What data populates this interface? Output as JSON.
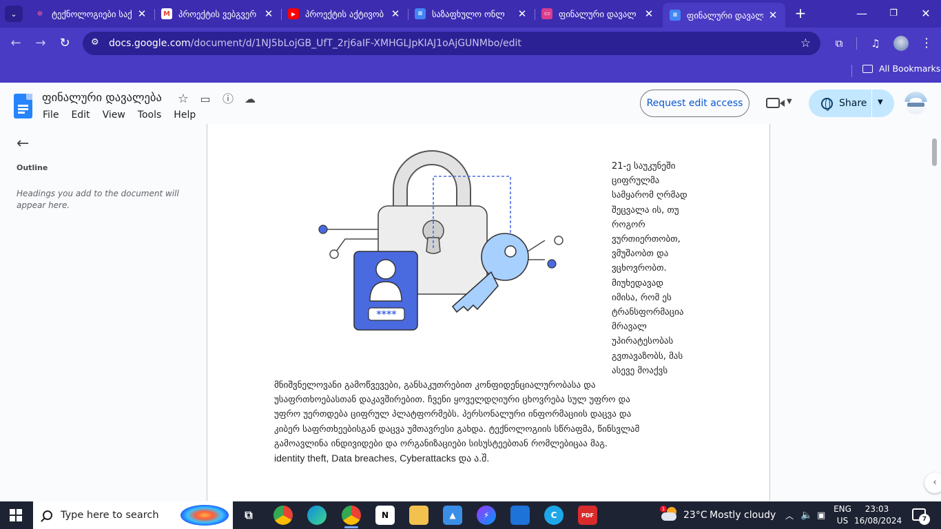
{
  "tabs": [
    {
      "title": "ტექნოლოგიები საქ",
      "favicon": "generic-site-icon",
      "color": "#c5408a"
    },
    {
      "title": "პროექტის ვებგვერ",
      "favicon": "gmail-icon",
      "color": "#ea4335"
    },
    {
      "title": "პროექტის აქტივობ",
      "favicon": "youtube-icon",
      "color": "#ff0000"
    },
    {
      "title": "საზაფხულო ონლ",
      "favicon": "docs-icon",
      "color": "#4285f4"
    },
    {
      "title": "ფინალური დავალ",
      "favicon": "slides-icon",
      "color": "#d93d8e"
    },
    {
      "title": "ფინალური დავალ",
      "favicon": "docs-icon",
      "color": "#4285f4"
    }
  ],
  "address": {
    "domain": "docs.google.com",
    "path": "/document/d/1NJ5bLojGB_UfT_2rj6aIF-XMHGLJpKIAJ1oAjGUNMbo/edit"
  },
  "bookmarks": {
    "all_label": "All Bookmarks"
  },
  "doc": {
    "title": "ფინალური დავალება",
    "menus": [
      "File",
      "Edit",
      "View",
      "Tools",
      "Help"
    ],
    "request_access_label": "Request edit access",
    "share_label": "Share"
  },
  "outline": {
    "title": "Outline",
    "hint": "Headings you add to the document will appear here."
  },
  "body": {
    "float_lines": [
      "21-ე საუკუნეში",
      "ციფრულმა",
      "სამყარომ ღრმად",
      "შეცვალა ის, თუ",
      "როგორ",
      "ვურთიერთობთ,",
      "ვმუშაობთ და",
      "ვცხოვრობთ.",
      "მიუხედავად",
      "იმისა, რომ ეს",
      "ტრანსფორმაცია",
      "მრავალ",
      "უპირატესობას",
      "გვთავაზობს, მას",
      "ასევე მოაქვს"
    ],
    "full_lines": [
      "მნიშვნელოვანი გამოწვევები, განსაკუთრებით კონფიდენციალურობასა და",
      "უსაფრთხოებასთან დაკავშირებით. ჩვენი ყოველდღიური ცხოვრება სულ უფრო და",
      "უფრო უერთდება ციფრულ პლატფორმებს. პერსონალური ინფორმაციის დაცვა და",
      "კიბერ საფრთხეებისგან დაცვა უმთავრესი გახდა. ტექნოლოგიის სწრაფმა, წინსვლამ",
      "გამოავლინა ინდივიდები და ორგანიზაციები სისუსტეებთან  რომლებიცაა  მაგ.",
      "identity theft, Data breaches, Cyberattacks და ა.შ."
    ],
    "password_mask": "****"
  },
  "taskbar": {
    "search_placeholder": "Type here to search",
    "weather_temp": "23°C",
    "weather_desc": "Mostly cloudy",
    "weather_badge": "1",
    "lang_line1": "ENG",
    "lang_line2": "US",
    "time": "23:03",
    "date": "16/08/2024",
    "notif_count": "7"
  },
  "colors": {
    "chrome_frame": "#3c2cb0",
    "chrome_toolbar": "#4a3bc4",
    "docs_blue": "#0b57d0",
    "share_bg": "#c2e7ff",
    "illustration_blue": "#4a6ae0",
    "key_blue": "#a8d0ff"
  }
}
